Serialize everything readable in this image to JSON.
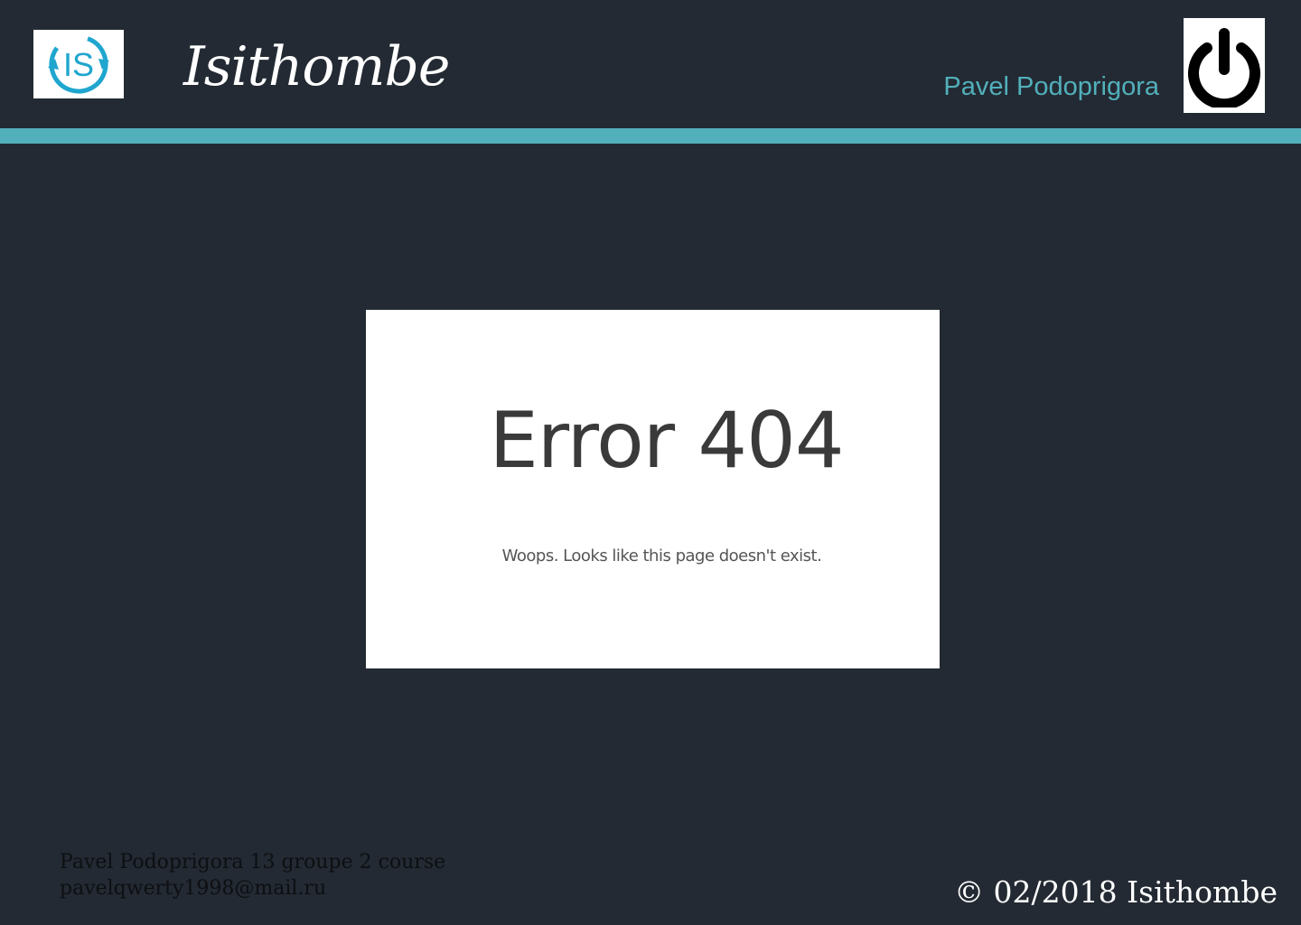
{
  "header": {
    "logo_icon": "isithombe-logo-icon",
    "logo_text": "IS",
    "site_title": "Isithombe",
    "user_name": "Pavel Podoprigora",
    "power_icon": "power-icon"
  },
  "colors": {
    "background": "#232a33",
    "accent": "#52b0bb",
    "logo_blue": "#1fa6cf"
  },
  "error": {
    "title": "Error 404",
    "message": "Woops. Looks like this page doesn't exist."
  },
  "footer": {
    "author_line": "Pavel Podoprigora 13 groupe 2 course",
    "email": "pavelqwerty1998@mail.ru",
    "copyright": "© 02/2018 Isithombe"
  }
}
